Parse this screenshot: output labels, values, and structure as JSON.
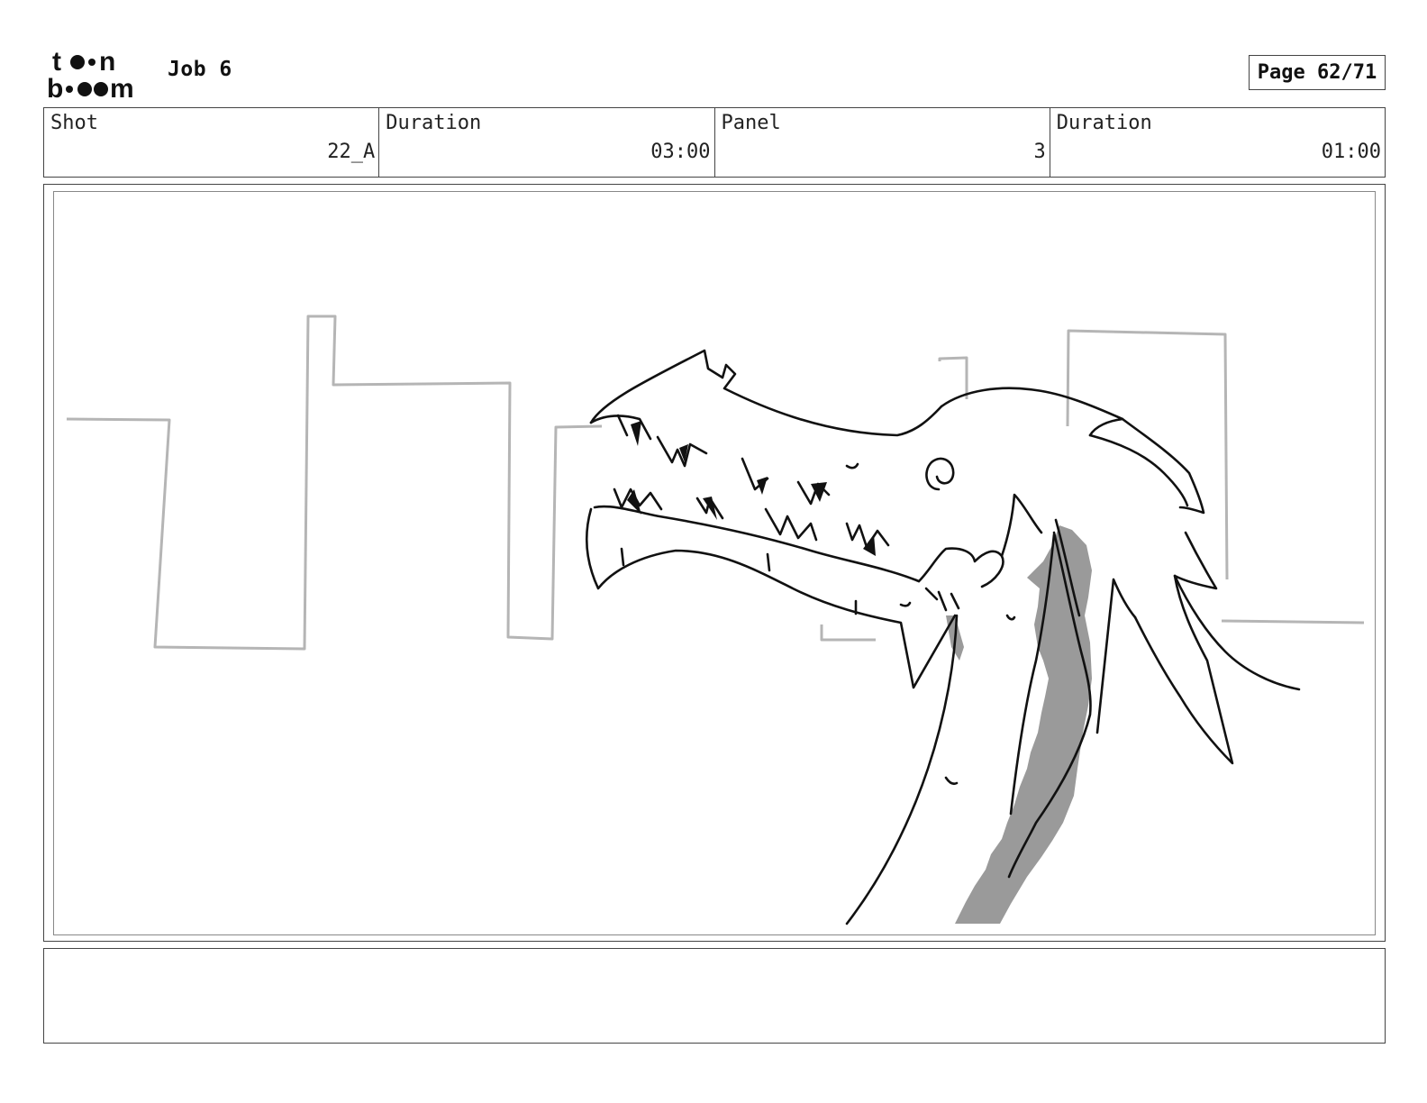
{
  "header": {
    "logo_icon": "toonboom-logo",
    "job_title": "Job 6",
    "page_label": "Page 62/71"
  },
  "info": {
    "shot_label": "Shot",
    "shot_value": "22_A",
    "shot_duration_label": "Duration",
    "shot_duration_value": "03:00",
    "panel_label": "Panel",
    "panel_value": "3",
    "panel_duration_label": "Duration",
    "panel_duration_value": "01:00"
  },
  "panel": {
    "drawing": "storyboard-sketch-dragon-head-city-skyline"
  },
  "notes": {
    "text": ""
  },
  "colors": {
    "line": "#111111",
    "background_sketch": "#b5b5b5",
    "shadow": "#9a9a9a"
  }
}
